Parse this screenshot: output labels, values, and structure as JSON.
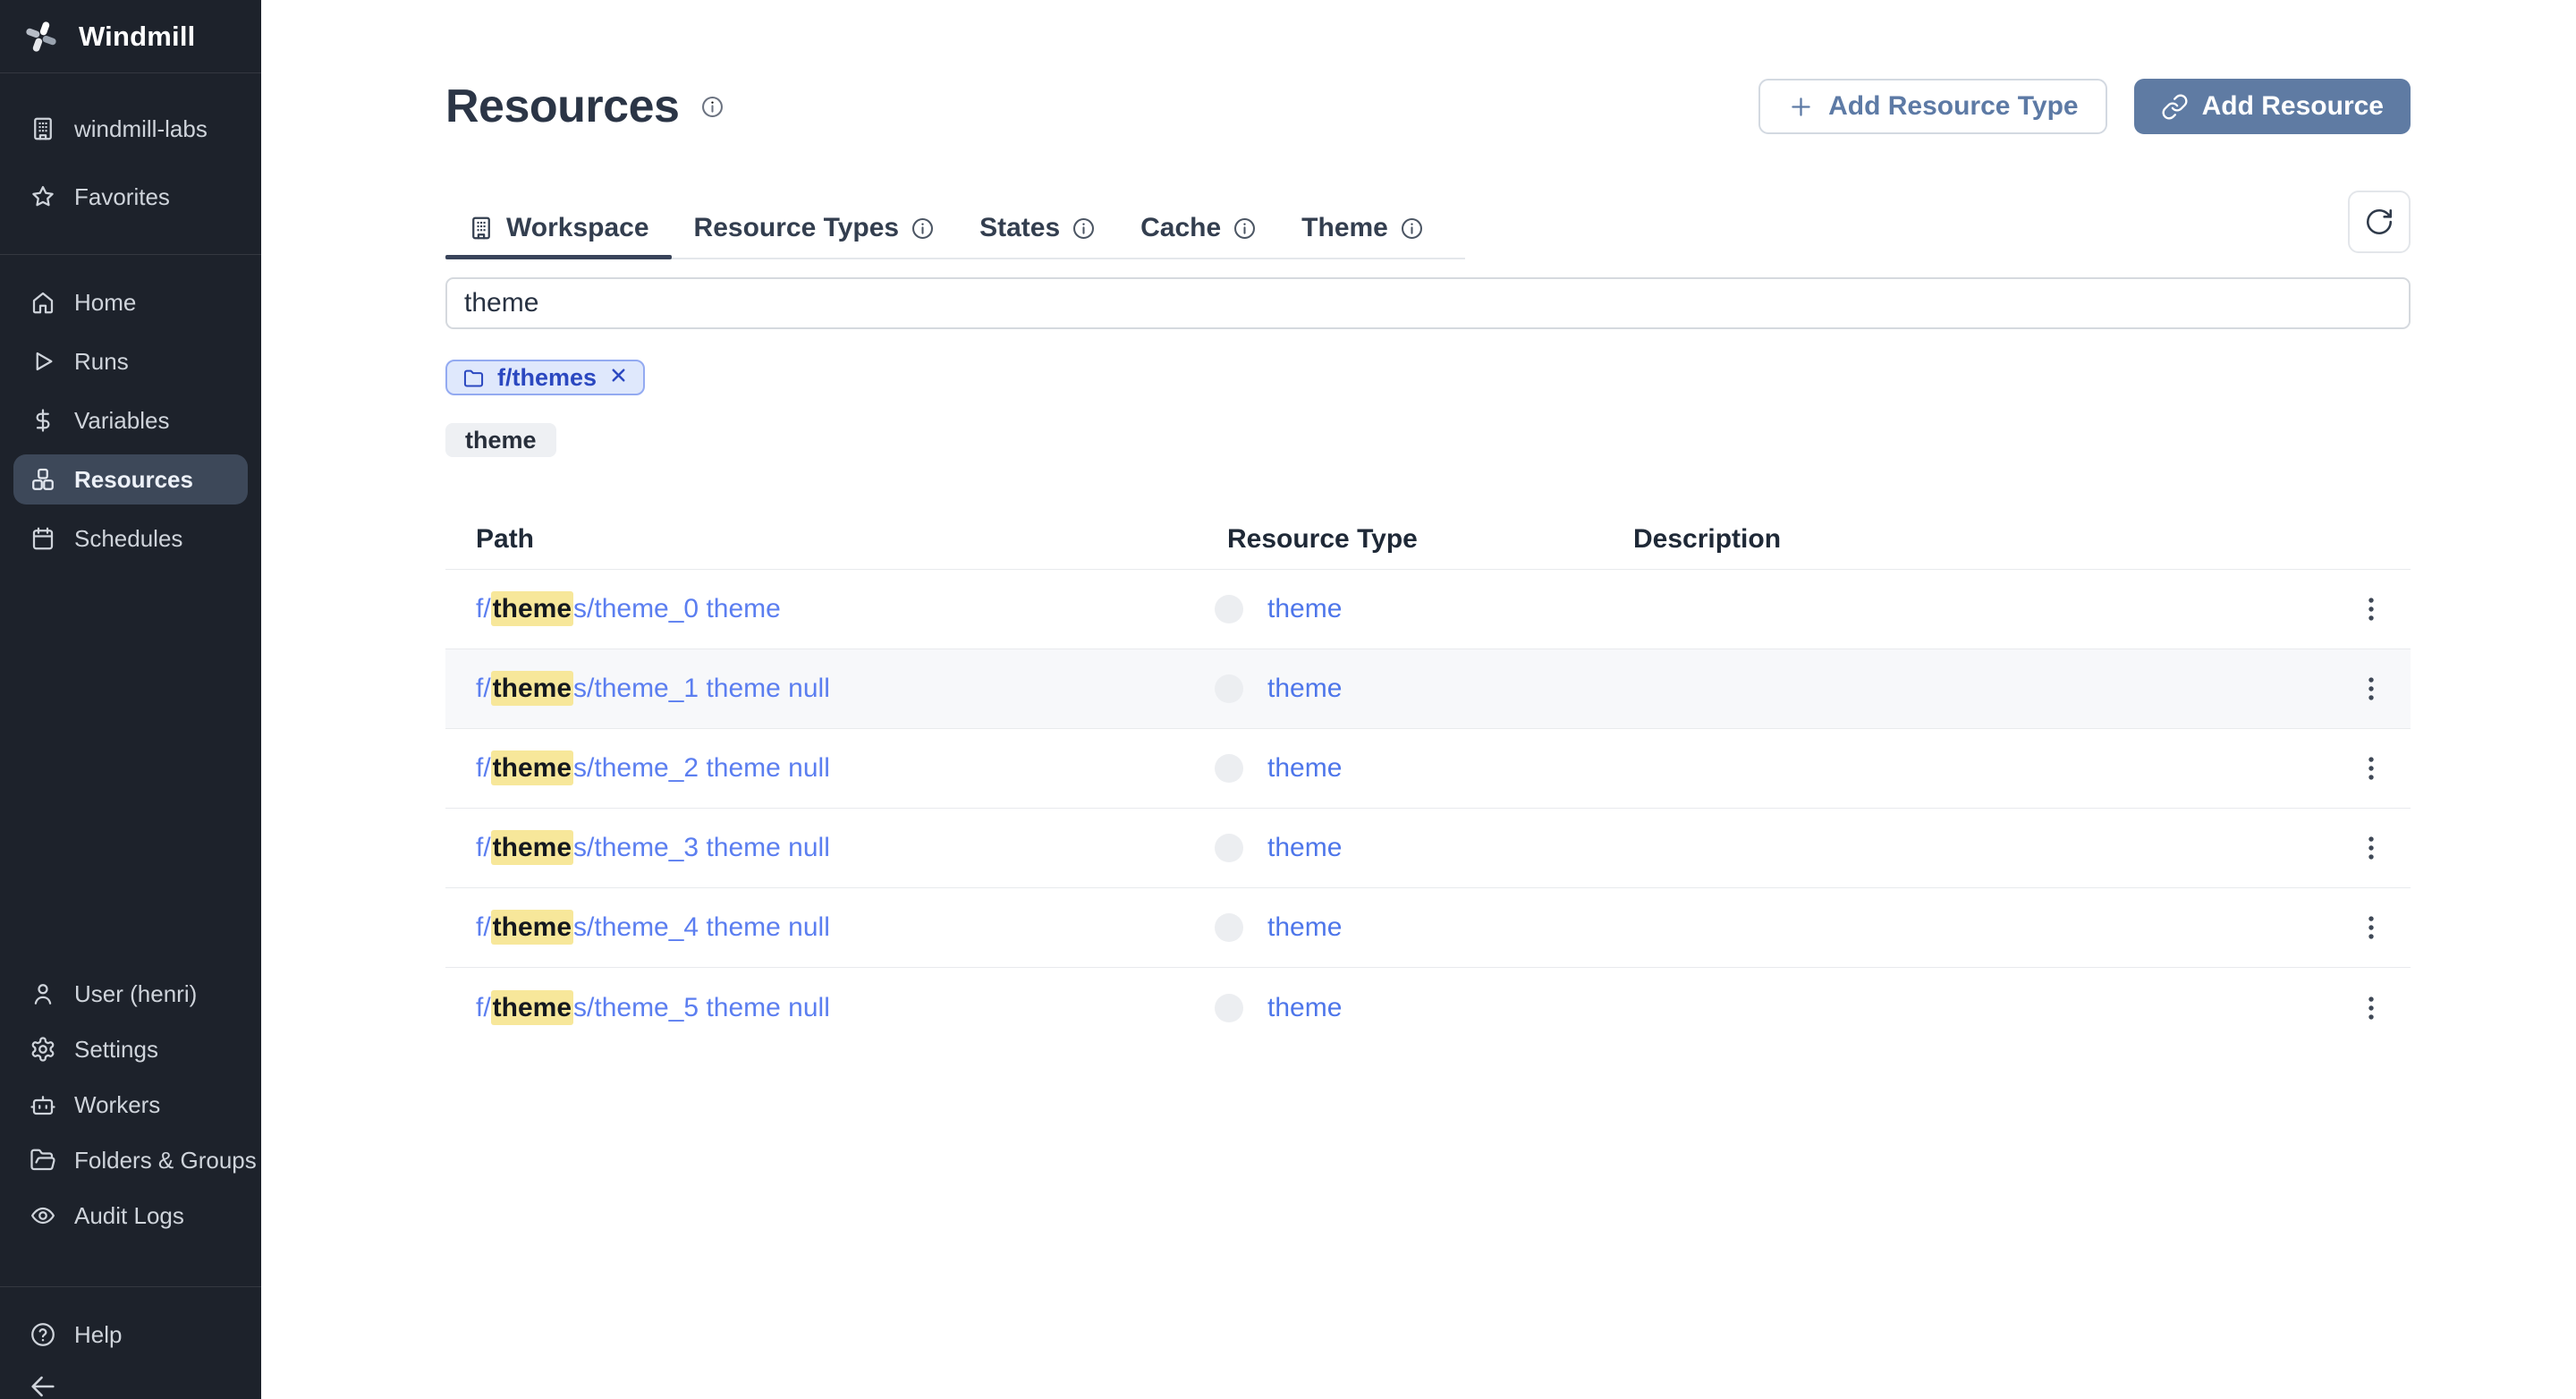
{
  "app": {
    "name": "Windmill"
  },
  "sidebar": {
    "logo_label": "Windmill",
    "workspace_label": "windmill-labs",
    "favorites_label": "Favorites",
    "nav_items": [
      {
        "label": "Home",
        "icon": "home-icon",
        "active": false
      },
      {
        "label": "Runs",
        "icon": "play-icon",
        "active": false
      },
      {
        "label": "Variables",
        "icon": "dollar-icon",
        "active": false
      },
      {
        "label": "Resources",
        "icon": "boxes-icon",
        "active": true
      },
      {
        "label": "Schedules",
        "icon": "calendar-icon",
        "active": false
      }
    ],
    "bottom_items": [
      {
        "label": "User (henri)",
        "icon": "user-icon"
      },
      {
        "label": "Settings",
        "icon": "gear-icon"
      },
      {
        "label": "Workers",
        "icon": "robot-icon"
      },
      {
        "label": "Folders & Groups",
        "icon": "folder-open-icon"
      },
      {
        "label": "Audit Logs",
        "icon": "eye-icon"
      }
    ],
    "help_label": "Help"
  },
  "header": {
    "title": "Resources",
    "add_resource_type_label": "Add Resource Type",
    "add_resource_label": "Add Resource"
  },
  "tabs": [
    {
      "label": "Workspace",
      "active": true,
      "has_icon": true,
      "has_info": false
    },
    {
      "label": "Resource Types",
      "active": false,
      "has_info": true
    },
    {
      "label": "States",
      "active": false,
      "has_info": true
    },
    {
      "label": "Cache",
      "active": false,
      "has_info": true
    },
    {
      "label": "Theme",
      "active": false,
      "has_info": true
    }
  ],
  "search": {
    "value": "theme"
  },
  "filters": {
    "folder_chip_label": "f/themes",
    "search_chip_label": "theme"
  },
  "table": {
    "columns": [
      "Path",
      "Resource Type",
      "Description"
    ],
    "rows": [
      {
        "path_prefix": "f/",
        "path_highlight": "theme",
        "path_suffix": "s/theme_0 theme",
        "resource_type": "theme",
        "description": "",
        "hovered": false
      },
      {
        "path_prefix": "f/",
        "path_highlight": "theme",
        "path_suffix": "s/theme_1 theme null",
        "resource_type": "theme",
        "description": "",
        "hovered": true
      },
      {
        "path_prefix": "f/",
        "path_highlight": "theme",
        "path_suffix": "s/theme_2 theme null",
        "resource_type": "theme",
        "description": "",
        "hovered": false
      },
      {
        "path_prefix": "f/",
        "path_highlight": "theme",
        "path_suffix": "s/theme_3 theme null",
        "resource_type": "theme",
        "description": "",
        "hovered": false
      },
      {
        "path_prefix": "f/",
        "path_highlight": "theme",
        "path_suffix": "s/theme_4 theme null",
        "resource_type": "theme",
        "description": "",
        "hovered": false
      },
      {
        "path_prefix": "f/",
        "path_highlight": "theme",
        "path_suffix": "s/theme_5 theme null",
        "resource_type": "theme",
        "description": "",
        "hovered": false
      }
    ]
  },
  "colors": {
    "sidebar_bg": "#1d222b",
    "sidebar_active_bg": "#3d4859",
    "accent_link_blue": "#4e76ea",
    "highlight_yellow": "#f7e79a",
    "primary_button_bg": "#5f7ba3",
    "chip_blue_text": "#2b48c0",
    "chip_blue_bg": "#dfe8fc"
  }
}
